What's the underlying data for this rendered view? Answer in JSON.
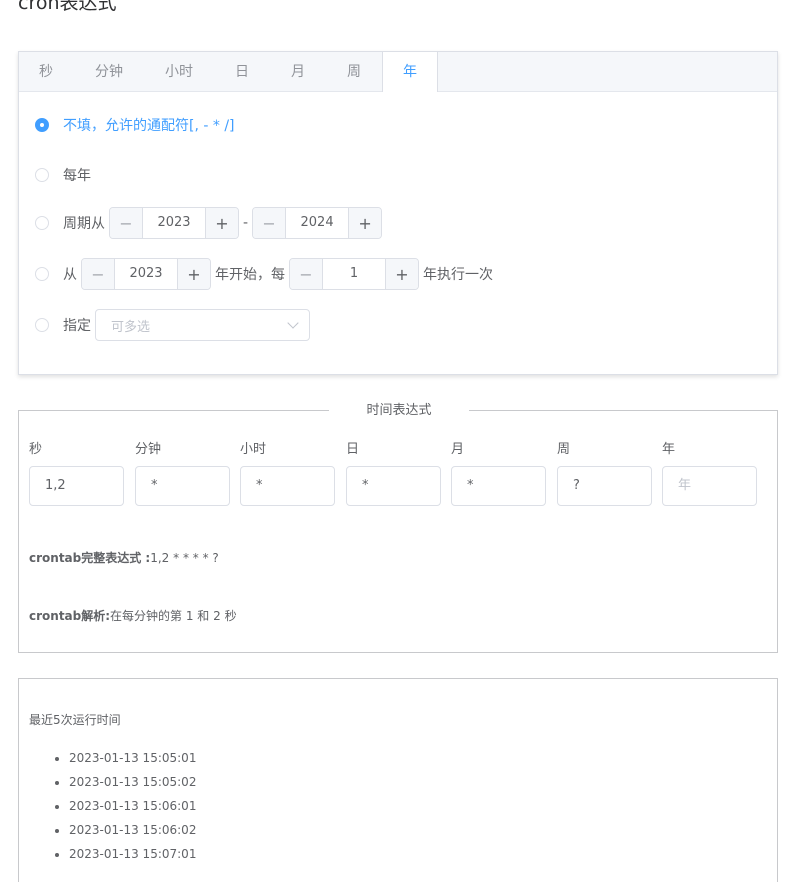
{
  "page_title": "cron表达式",
  "tabs": [
    {
      "label": "秒"
    },
    {
      "label": "分钟"
    },
    {
      "label": "小时"
    },
    {
      "label": "日"
    },
    {
      "label": "月"
    },
    {
      "label": "周"
    },
    {
      "label": "年"
    }
  ],
  "active_tab": "年",
  "accent_color": "#409eff",
  "options": {
    "unfilled": "不填，允许的通配符[, - * /]",
    "every_year": "每年",
    "period_from": "周期从",
    "period_dash": "-",
    "from": "从",
    "year_start_every": "年开始，每",
    "year_execute_once": "年执行一次",
    "specify": "指定"
  },
  "steppers": {
    "period_start": "2023",
    "period_end": "2024",
    "from_start": "2023",
    "from_interval": "1",
    "minus": "−",
    "plus": "+"
  },
  "select": {
    "placeholder": "可多选"
  },
  "expression": {
    "legend": "时间表达式",
    "columns": [
      {
        "label": "秒",
        "value": "1,2"
      },
      {
        "label": "分钟",
        "value": "*"
      },
      {
        "label": "小时",
        "value": "*"
      },
      {
        "label": "日",
        "value": "*"
      },
      {
        "label": "月",
        "value": "*"
      },
      {
        "label": "周",
        "value": "?"
      },
      {
        "label": "年",
        "value": "",
        "placeholder": "年"
      }
    ],
    "full_label": "crontab完整表达式 :",
    "full_value": "1,2 * * * * ?",
    "parse_label": "crontab解析:",
    "parse_value": "在每分钟的第 1 和 2 秒"
  },
  "runtime": {
    "title": "最近5次运行时间",
    "times": [
      "2023-01-13 15:05:01",
      "2023-01-13 15:05:02",
      "2023-01-13 15:06:01",
      "2023-01-13 15:06:02",
      "2023-01-13 15:07:01"
    ]
  }
}
